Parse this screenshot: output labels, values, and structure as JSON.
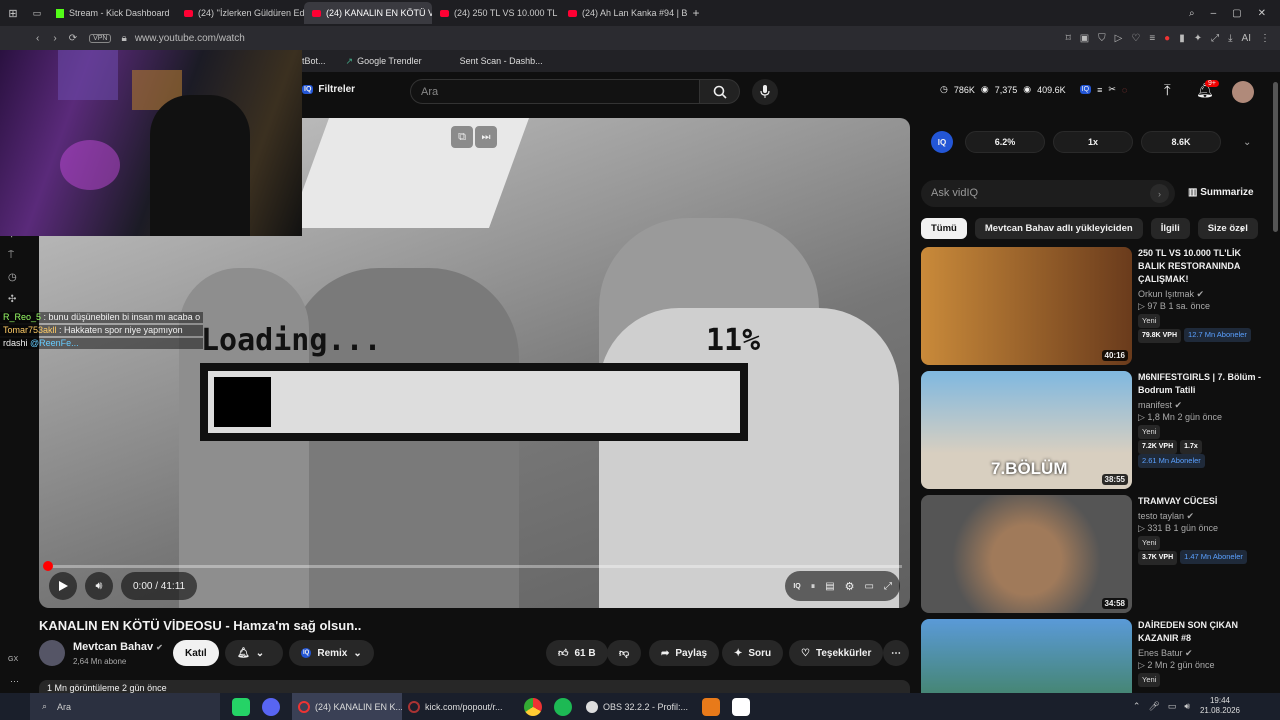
{
  "browser": {
    "tabs": [
      {
        "title": "Stream - Kick Dashboard",
        "icon": "kick"
      },
      {
        "title": "(24) ''İzlerken Güldüren Ed",
        "icon": "youtube"
      },
      {
        "title": "(24) KANALIN EN KÖTÜ Vİ",
        "icon": "youtube",
        "active": true
      },
      {
        "title": "(24) 250 TL VS 10.000 TL",
        "icon": "youtube"
      },
      {
        "title": "(24) Ah Lan Kanka #94 | B",
        "icon": "youtube"
      }
    ],
    "vpn_label": "VPN",
    "url": "www.youtube.com/watch",
    "bookmarks": [
      "tBot...",
      "Google Trendler",
      "Sent Scan - Dashb..."
    ]
  },
  "youtube": {
    "filter_label": "Filtreler",
    "search_placeholder": "Ara",
    "notif_count": "9+",
    "stats": {
      "a": "786K",
      "b": "7,375",
      "c": "409.6K"
    },
    "video": {
      "overlay_loading": "Loading...",
      "overlay_percent": "11%",
      "progress_fraction": 0.11,
      "time": "0:00 / 41:11"
    },
    "title": "KANALIN EN KÖTÜ VİDEOSU - Hamza'm sağ olsun..",
    "channel": {
      "name": "Mevtcan Bahav",
      "subs": "2,64 Mn abone"
    },
    "join_label": "Katıl",
    "remix_label": "Remix",
    "likes": "61 B",
    "share_label": "Paylaş",
    "ask_label": "Soru",
    "thanks_label": "Teşekkürler",
    "description": "1 Mn görüntüleme  2 gün önce",
    "iq": {
      "badge": "IQ",
      "v1": "6.2%",
      "v2": "1x",
      "v3": "8.6K"
    },
    "ask_placeholder": "Ask vidIQ",
    "summarize_label": "Summarize",
    "chips": [
      "Tümü",
      "Mevtcan Bahav adlı yükleyiciden",
      "İlgili",
      "Size özel"
    ],
    "recommendations": [
      {
        "title": "250 TL VS 10.000 TL'LİK BALIK RESTORANINDA ÇALIŞMAK!",
        "channel": "Orkun Işıtmak",
        "views": "97 B",
        "age": "1 sa. önce",
        "badge": "Yeni",
        "vph": "79.8K VPH",
        "subs": "12.7 Mn Aboneler",
        "duration": "40:16",
        "color1": "#c98a3a",
        "color2": "#6a3b1c"
      },
      {
        "title": "M6NIFESTGIRLS | 7. Bölüm - Bodrum Tatili",
        "channel": "manifest",
        "views": "1,8 Mn",
        "age": "2 gün önce",
        "badge": "Yeni",
        "vph": "7.2K VPH",
        "ratio": "1.7x",
        "subs": "2.61 Mn Aboneler",
        "duration": "38:55",
        "overlay": "7.BÖLÜM",
        "color1": "#7fb8e0",
        "color2": "#d8cfc0"
      },
      {
        "title": "TRAMVAY CÜCESİ",
        "channel": "testo taylan",
        "views": "331 B",
        "age": "1 gün önce",
        "badge": "Yeni",
        "vph": "3.7K VPH",
        "subs": "1.47 Mn Aboneler",
        "duration": "34:58",
        "color1": "#555",
        "color2": "#a07a5a"
      },
      {
        "title": "DAİREDEN SON ÇIKAN KAZANIR #8",
        "channel": "Enes Batur",
        "views": "2 Mn",
        "age": "2 gün önce",
        "badge": "Yeni",
        "color1": "#5a9ad8",
        "color2": "#3a7a3a"
      }
    ]
  },
  "chat": [
    {
      "user": "R_Reo_5",
      "text": "bunu düşünebilen bi insan mı acaba o"
    },
    {
      "user": "Tomar753akll",
      "text": "Hakkaten spor niye yapmıyon"
    },
    {
      "user": "rdashi",
      "text": "@ReenFe..."
    }
  ],
  "taskbar": {
    "search": "Ara",
    "tasks": [
      "(24) KANALIN EN K...",
      "kick.com/popout/r...",
      "OBS 32.2.2 - Profil:..."
    ],
    "time": "19:44",
    "date": "21.08.2026"
  }
}
